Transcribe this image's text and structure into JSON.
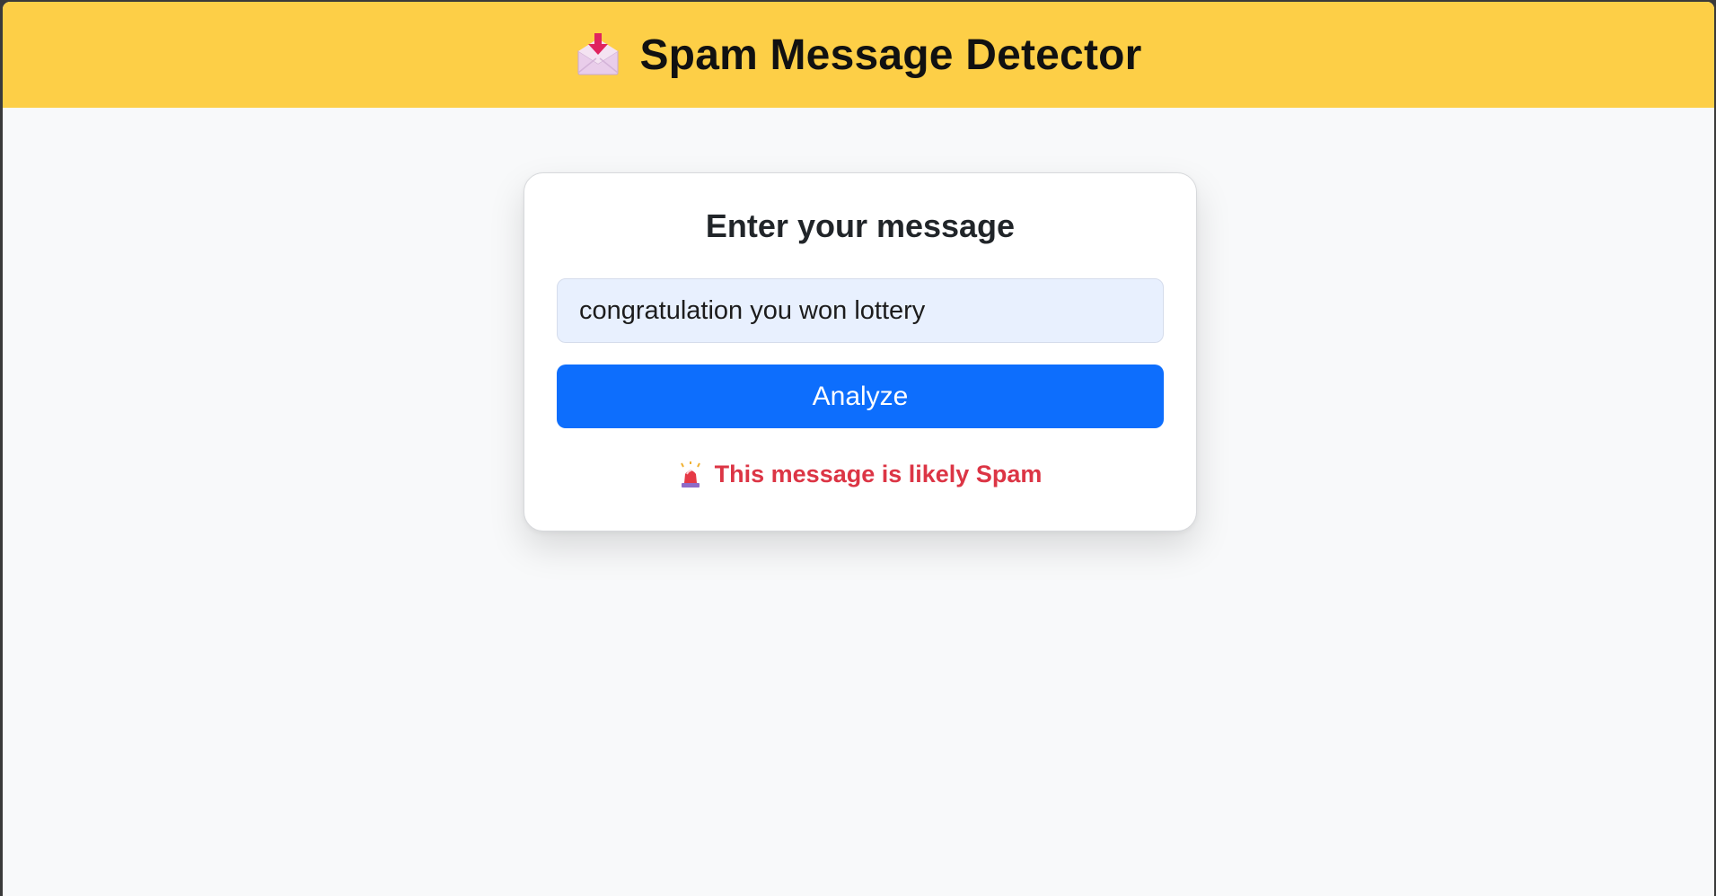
{
  "header": {
    "icon": "inbox-download-icon",
    "title": "Spam Message Detector",
    "background": "#fdcf47"
  },
  "card": {
    "title": "Enter your message",
    "input": {
      "value": "congratulation you won lottery",
      "placeholder": ""
    },
    "button_label": "Analyze",
    "button_color": "#0d6efd",
    "result": {
      "icon": "siren-icon",
      "text": "This message is likely Spam",
      "color": "#dc3545"
    }
  }
}
